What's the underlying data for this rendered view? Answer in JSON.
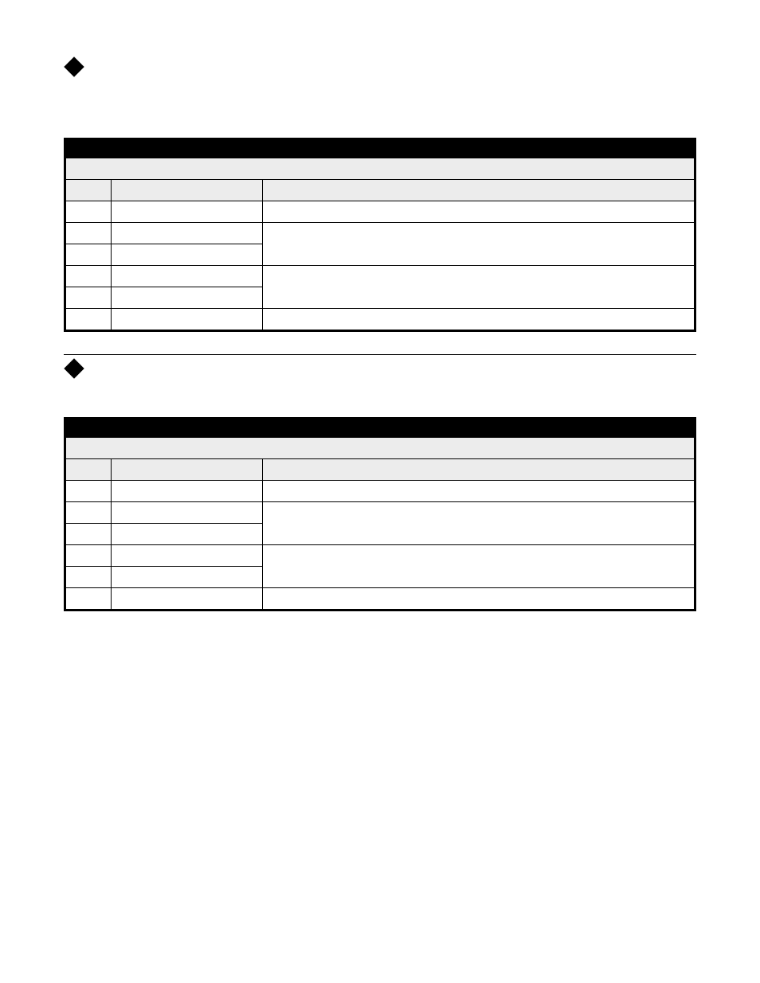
{
  "sections": [
    {
      "pre_rule": false,
      "header_text": "",
      "intro_lines": [
        "",
        ""
      ],
      "table": {
        "title": "",
        "subhead": "",
        "col_headers": [
          "",
          "",
          ""
        ],
        "rows": [
          {
            "cells": [
              "",
              "",
              ""
            ]
          },
          {
            "cells": [
              "",
              "",
              ""
            ],
            "merge_right": 2
          },
          {
            "cells": [
              "",
              "",
              ""
            ]
          },
          {
            "cells": [
              "",
              "",
              ""
            ],
            "merge_right": 2
          },
          {
            "cells": [
              "",
              "",
              ""
            ]
          },
          {
            "cells": [
              "",
              "",
              ""
            ]
          }
        ]
      }
    },
    {
      "pre_rule": true,
      "header_text": "",
      "intro_lines": [
        ""
      ],
      "table": {
        "title": "",
        "subhead": "",
        "col_headers": [
          "",
          "",
          ""
        ],
        "rows": [
          {
            "cells": [
              "",
              "",
              ""
            ]
          },
          {
            "cells": [
              "",
              "",
              ""
            ],
            "merge_right": 2
          },
          {
            "cells": [
              "",
              "",
              ""
            ]
          },
          {
            "cells": [
              "",
              "",
              ""
            ],
            "merge_right": 2
          },
          {
            "cells": [
              "",
              "",
              ""
            ]
          },
          {
            "cells": [
              "",
              "",
              ""
            ]
          }
        ]
      }
    }
  ]
}
